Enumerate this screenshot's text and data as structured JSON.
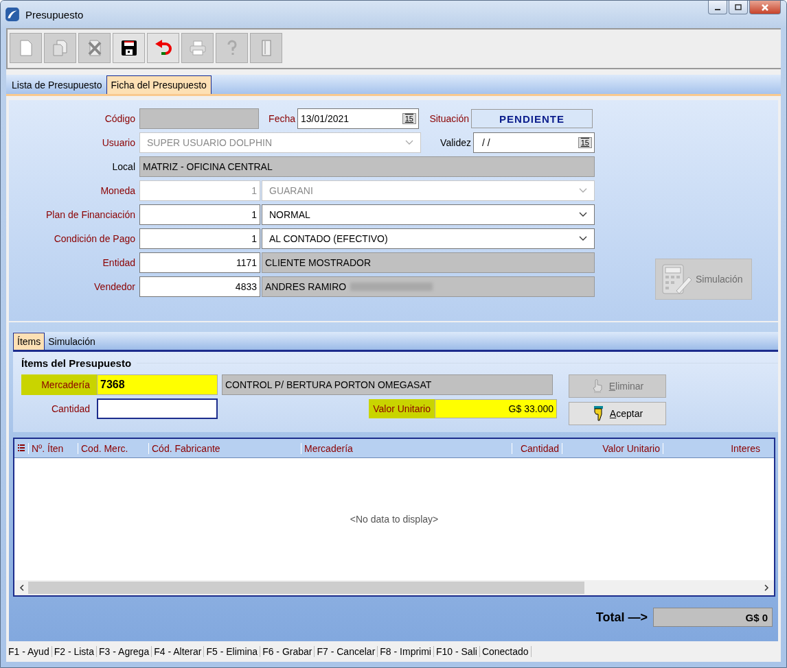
{
  "window": {
    "title": "Presupuesto"
  },
  "toolbar": [
    {
      "kind": "new",
      "disabled": true
    },
    {
      "kind": "copy",
      "disabled": true
    },
    {
      "kind": "delete",
      "disabled": true
    },
    {
      "kind": "save",
      "disabled": false
    },
    {
      "kind": "undo",
      "disabled": false
    },
    {
      "kind": "print",
      "disabled": true
    },
    {
      "kind": "help",
      "disabled": true
    },
    {
      "kind": "exit",
      "disabled": true
    }
  ],
  "tabs": [
    {
      "label": "Lista de Presupuesto",
      "selected": false
    },
    {
      "label": "Ficha del Presupuesto",
      "selected": true
    }
  ],
  "form": {
    "codigo": {
      "label": "Código",
      "required": true
    },
    "fecha": {
      "label": "Fecha",
      "required": true,
      "value": "13/01/2021",
      "button_label": "15"
    },
    "situacion": {
      "label": "Situación",
      "required": true,
      "value": "PENDIENTE"
    },
    "usuario": {
      "label": "Usuario",
      "required": true,
      "value": "SUPER USUARIO DOLPHIN",
      "disabled": true
    },
    "validez": {
      "label": "Validez",
      "required": false,
      "value": "/ /",
      "button_label": "15"
    },
    "local": {
      "label": "Local",
      "required": false,
      "value": "MATRIZ - OFICINA CENTRAL"
    },
    "lookups": [
      {
        "label": "Moneda",
        "required": true,
        "code": "1",
        "name": "GUARANI",
        "kind": "combo",
        "disabled": true,
        "redacted": false
      },
      {
        "label": "Plan de Financiación",
        "required": true,
        "code": "1",
        "name": "NORMAL",
        "kind": "combo",
        "disabled": false,
        "redacted": false
      },
      {
        "label": "Condición de Pago",
        "required": true,
        "code": "1",
        "name": "AL CONTADO (EFECTIVO)",
        "kind": "combo",
        "disabled": false,
        "redacted": false
      },
      {
        "label": "Entidad",
        "required": true,
        "code": "1171",
        "name": "CLIENTE MOSTRADOR",
        "kind": "lookup",
        "disabled": false,
        "redacted": false
      },
      {
        "label": "Vendedor",
        "required": true,
        "code": "4833",
        "name": "ANDRES RAMIRO",
        "kind": "lookup",
        "disabled": false,
        "redacted": true
      }
    ],
    "simulation_button": {
      "label": "Simulación",
      "disabled": true
    }
  },
  "subtabs": [
    {
      "label": "Ítems",
      "selected": true
    },
    {
      "label": "Simulación",
      "selected": false
    }
  ],
  "items": {
    "title": "Ítems del Presupuesto",
    "mercaderia": {
      "label": "Mercadería",
      "code": "7368",
      "name": "CONTROL P/ BERTURA PORTON OMEGASAT",
      "highlighted": true
    },
    "cantidad": {
      "label": "Cantidad",
      "highlighted": false
    },
    "valor_unitario": {
      "label": "Valor Unitario",
      "value": "G$ 33.000",
      "highlighted": true
    },
    "buttons": [
      {
        "label": "Eliminar",
        "kind": "hand",
        "disabled": true
      },
      {
        "label": "Aceptar",
        "kind": "pointer",
        "disabled": false
      }
    ]
  },
  "table": {
    "columns": [
      {
        "label": "Nº. Íten"
      },
      {
        "label": "Cod. Merc."
      },
      {
        "label": "Cód. Fabricante"
      },
      {
        "label": "Mercadería"
      },
      {
        "label": "Cantidad"
      },
      {
        "label": "Valor Unitario"
      },
      {
        "label": "Interes"
      }
    ],
    "empty_text": "<No data to display>"
  },
  "total": {
    "label": "Total —>",
    "value": "G$ 0"
  },
  "status_bar": [
    "F1 - Ayud",
    "F2 - Lista",
    "F3 - Agrega",
    "F4 - Alterar",
    "F5 - Elimina",
    "F6 - Grabar",
    "F7 - Cancelar",
    "F8 - Imprimi",
    "F10 - Sali",
    "Conectado"
  ]
}
